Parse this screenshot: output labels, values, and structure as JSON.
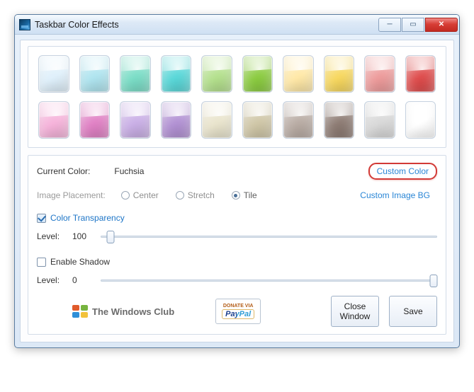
{
  "window": {
    "title": "Taskbar Color Effects"
  },
  "swatches": {
    "row1": [
      "#dff0fb",
      "#aee4ef",
      "#79ddc6",
      "#57d7d8",
      "#b3e08c",
      "#8acb3e",
      "#ffe8a6",
      "#f7d75d",
      "#ed9a9a",
      "#de4a4a"
    ],
    "row2": [
      "#f6b2da",
      "#e07fc4",
      "#c9aee6",
      "#b190d3",
      "#e9e4cc",
      "#cfc6a6",
      "#b8aba3",
      "#8c7a72",
      "#d8d8d8",
      "#ffffff"
    ]
  },
  "settings": {
    "current_color_label": "Current Color:",
    "current_color_value": "Fuchsia",
    "custom_color_link": "Custom Color",
    "placement_label": "Image Placement:",
    "placement_options": {
      "center": "Center",
      "stretch": "Stretch",
      "tile": "Tile"
    },
    "placement_selected": "tile",
    "custom_image_link": "Custom Image BG",
    "transparency_label": "Color Transparency",
    "transparency_checked": true,
    "transparency_level_label": "Level:",
    "transparency_level_value": "100",
    "transparency_slider_pct": 3,
    "shadow_label": "Enable Shadow",
    "shadow_checked": false,
    "shadow_level_label": "Level:",
    "shadow_level_value": "0",
    "shadow_slider_pct": 99
  },
  "footer": {
    "brand": "The Windows Club",
    "donate_top": "DONATE VIA",
    "donate_brand": "PayPal",
    "close_label": "Close\nWindow",
    "save_label": "Save"
  }
}
